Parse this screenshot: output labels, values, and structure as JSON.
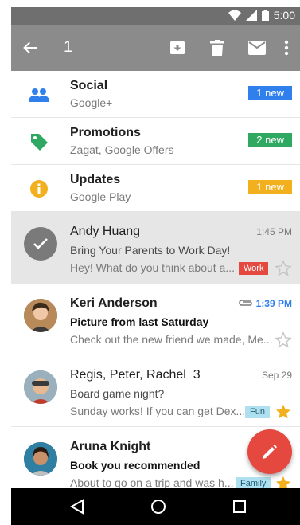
{
  "status_bar": {
    "time": "5:00"
  },
  "app_bar": {
    "selected_count": "1"
  },
  "categories": [
    {
      "title": "Social",
      "subtitle": "Google+",
      "badge": "1 new",
      "color": "#2f80ed"
    },
    {
      "title": "Promotions",
      "subtitle": "Zagat, Google Offers",
      "badge": "2 new",
      "color": "#2fa862"
    },
    {
      "title": "Updates",
      "subtitle": "Google Play",
      "badge": "1 new",
      "color": "#f2b01e"
    }
  ],
  "emails": [
    {
      "sender": "Andy Huang",
      "time": "1:45 PM",
      "subject": "Bring Your Parents to Work Day!",
      "snippet": "Hey! What do you think about a...",
      "label": "Work",
      "label_color": "#e5483f"
    },
    {
      "sender": "Keri Anderson",
      "time": "1:39 PM",
      "subject": "Picture from last Saturday",
      "snippet": "Check out the new friend we made, Me..."
    },
    {
      "sender": "Regis, Peter, Rachel",
      "count": "3",
      "time": "Sep 29",
      "subject": "Board game night?",
      "snippet": "Sunday works! If you can get Dex...",
      "label": "Fun",
      "label_color": "#aee0ef"
    },
    {
      "sender": "Aruna Knight",
      "subject": "Book you recommended",
      "snippet": "About to go on a trip and was h...",
      "label": "Family",
      "label_color": "#aee0ef"
    }
  ],
  "colors": {
    "app_bar": "#8b8b8b",
    "fab": "#e5483f",
    "star": "#f2b01e"
  }
}
